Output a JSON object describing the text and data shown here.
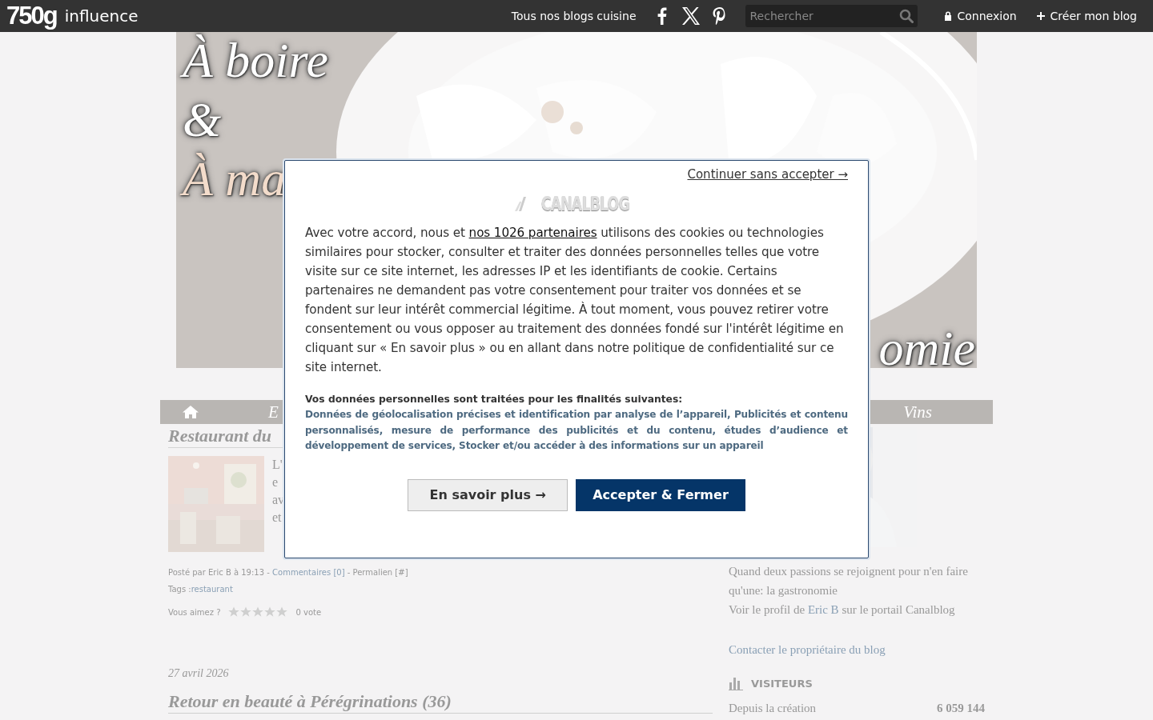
{
  "top_bar": {
    "logo": "750g",
    "logo_suffix": "influence",
    "link": "Tous nos blogs cuisine",
    "search": {
      "placeholder": "Rechercher"
    },
    "account_links": [
      {
        "kind": "lock",
        "label": "Connexion"
      },
      {
        "kind": "plus",
        "label": "Créer mon blog"
      }
    ]
  },
  "header": {
    "title_lines": [
      "À boire",
      "&",
      "À ma"
    ],
    "title_tail": "omie"
  },
  "nav": {
    "items": [
      {
        "kind": "home"
      },
      {
        "kind": "text",
        "label": "E"
      },
      {
        "kind": "text",
        "label": "Vins"
      }
    ]
  },
  "post": {
    "title": "Restaurant du",
    "excerpt_lines": [
      "L'",
      "e",
      "av",
      "et"
    ],
    "meta_before": "Posté par Eric B à 19:13 - ",
    "comments_link": "Commentaires [0]",
    "meta_after": " - Permalien [#]",
    "tags_label": "Tags : ",
    "tag": "restaurant",
    "rating_label": "Vous aimez ?",
    "stars": 0,
    "votes": "0 vote"
  },
  "next_post": {
    "date": "27 avril 2026",
    "title": "Retour en beauté à Pérégrinations (36)"
  },
  "sidebar": {
    "description": "Quand deux passions se rejoignent pour n'en faire qu'une: la gastronomie",
    "profile_before": "Voir le profil de ",
    "profile_link": "Eric B",
    "profile_after": " sur le portail Canalblog",
    "contact": "Contacter le propriétaire du blog",
    "visitors": {
      "title": "VISITEURS",
      "rows": [
        {
          "label": "Depuis la création",
          "value": "6 059 144"
        }
      ]
    }
  },
  "consent": {
    "skip_link": "Continuer sans accepter →",
    "logo": "CANALBLOG",
    "intro_before": "Avec votre accord, nous et ",
    "partners_link": "nos 1026 partenaires",
    "intro_after": " utilisons des cookies ou technologies similaires pour stocker, consulter et traiter des données personnelles telles que votre visite sur ce site internet, les adresses IP et les identifiants de cookie. Certains partenaires ne demandent pas votre consentement pour traiter vos données et se fondent sur leur intérêt commercial légitime. À tout moment, vous pouvez retirer votre consentement ou vous opposer au traitement des données fondé sur l'intérêt légitime en cliquant sur « En savoir plus » ou en allant dans notre politique de confidentialité sur ce site internet.",
    "purposes_title": "Vos données personnelles sont traitées pour les finalités suivantes:",
    "purposes": "Données de géolocalisation précises et identification par analyse de l’appareil, Publicités et contenu personnalisés, mesure de performance des publicités et du contenu, études d’audience et développement de services, Stocker et/ou accéder à des informations sur un appareil",
    "buttons": [
      {
        "kind": "secondary",
        "label": "En savoir plus →"
      },
      {
        "kind": "primary",
        "label": "Accepter & Fermer"
      }
    ]
  }
}
